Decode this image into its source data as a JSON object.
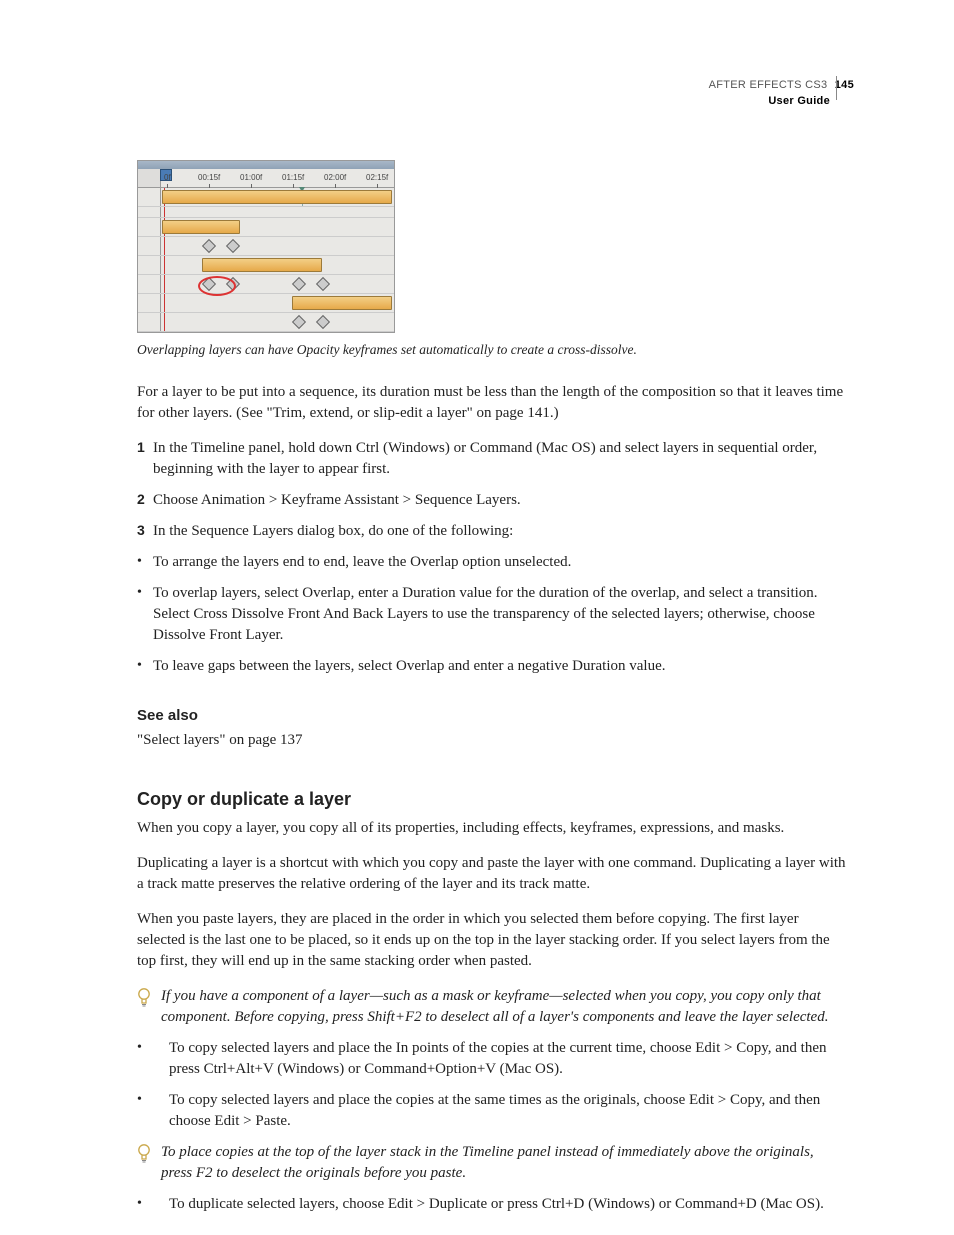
{
  "header": {
    "product": "AFTER EFFECTS CS3",
    "doc": "User Guide",
    "page": "145"
  },
  "figure": {
    "caption": "Overlapping layers can have Opacity keyframes set automatically to create a cross-dissolve.",
    "ticks": [
      "00:15f",
      "01:00f",
      "01:15f",
      "02:00f",
      "02:15f"
    ],
    "zero": "0f"
  },
  "p1": "For a layer to be put into a sequence, its duration must be less than the length of the composition so that it leaves time for other layers. (See \"Trim, extend, or slip-edit a layer\" on page 141.)",
  "steps": [
    "In the Timeline panel, hold down Ctrl (Windows) or Command (Mac OS) and select layers in sequential order, beginning with the layer to appear first.",
    "Choose Animation > Keyframe Assistant > Sequence Layers.",
    "In the Sequence Layers dialog box, do one of the following:"
  ],
  "bullets1": [
    "To arrange the layers end to end, leave the Overlap option unselected.",
    "To overlap layers, select Overlap, enter a Duration value for the duration of the overlap, and select a transition. Select Cross Dissolve Front And Back Layers to use the transparency of the selected layers; otherwise, choose Dissolve Front Layer.",
    "To leave gaps between the layers, select Overlap and enter a negative Duration value."
  ],
  "seeAlso": {
    "heading": "See also",
    "item": "\"Select layers\" on page 137"
  },
  "topic2": {
    "title": "Copy or duplicate a layer",
    "p1": "When you copy a layer, you copy all of its properties, including effects, keyframes, expressions, and masks.",
    "p2": "Duplicating a layer is a shortcut with which you copy and paste the layer with one command. Duplicating a layer with a track matte preserves the relative ordering of the layer and its track matte.",
    "p3": "When you paste layers, they are placed in the order in which you selected them before copying. The first layer selected is the last one to be placed, so it ends up on the top in the layer stacking order. If you select layers from the top first, they will end up in the same stacking order when pasted.",
    "tip1": "If you have a component of a layer—such as a mask or keyframe—selected when you copy, you copy only that component. Before copying, press Shift+F2 to deselect all of a layer's components and leave the layer selected.",
    "bullets": [
      "To copy selected layers and place the In points of the copies at the current time, choose Edit > Copy, and then press Ctrl+Alt+V (Windows) or Command+Option+V (Mac OS).",
      "To copy selected layers and place the copies at the same times as the originals, choose Edit > Copy, and then choose Edit > Paste."
    ],
    "tip2": "To place copies at the top of the layer stack in the Timeline panel instead of immediately above the originals, press F2 to deselect the originals before you paste.",
    "bullet3": "To duplicate selected layers, choose Edit > Duplicate or press Ctrl+D (Windows) or Command+D (Mac OS)."
  }
}
